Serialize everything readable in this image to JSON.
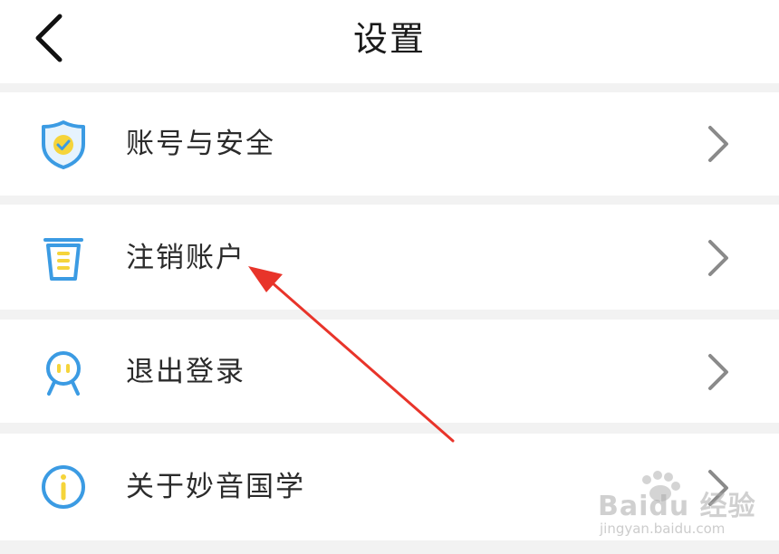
{
  "header": {
    "title": "设置"
  },
  "items": [
    {
      "label": "账号与安全",
      "icon": "shield-check-icon"
    },
    {
      "label": "注销账户",
      "icon": "trash-icon"
    },
    {
      "label": "退出登录",
      "icon": "avatar-icon"
    },
    {
      "label": "关于妙音国学",
      "icon": "info-icon"
    }
  ],
  "colors": {
    "icon_blue": "#3b9be3",
    "icon_yellow": "#f5d43a",
    "annotation_red": "#e8342a",
    "chevron": "#8a8a8a"
  },
  "watermark": {
    "brand": "Baidu 经验",
    "url": "jingyan.baidu.com"
  }
}
